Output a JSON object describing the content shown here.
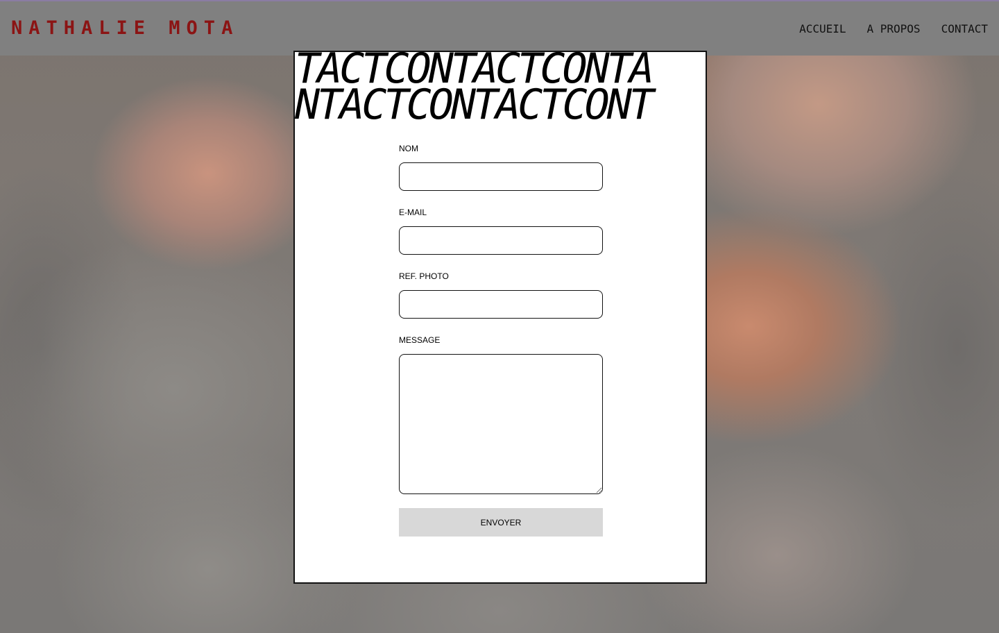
{
  "site": {
    "logo": "NATHALIE MOTA"
  },
  "nav": {
    "items": [
      {
        "label": "ACCUEIL"
      },
      {
        "label": "A PROPOS"
      },
      {
        "label": "CONTACT"
      }
    ]
  },
  "modal": {
    "marquee_line_1": "TACTCONTACTCONTA",
    "marquee_line_2": "NTACTCONTACTCONT",
    "form": {
      "name_label": "NOM",
      "name_value": "",
      "email_label": "E-MAIL",
      "email_value": "",
      "ref_label": "REF. PHOTO",
      "ref_value": "",
      "message_label": "MESSAGE",
      "message_value": "",
      "submit_label": "ENVOYER"
    }
  },
  "colors": {
    "logo": "#8b1414",
    "overlay": "#808080",
    "submit_bg": "#d8d8d8"
  }
}
